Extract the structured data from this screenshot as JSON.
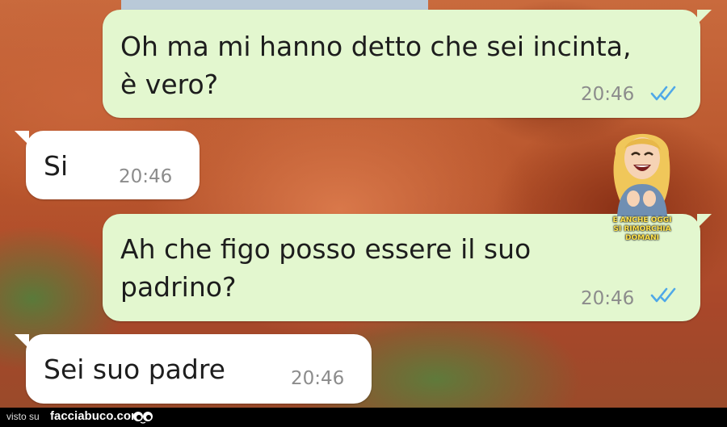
{
  "messages": [
    {
      "direction": "sent",
      "text": "Oh ma mi hanno detto che sei incinta,\nè vero?",
      "time": "20:46",
      "status": "read"
    },
    {
      "direction": "received",
      "text": "Si",
      "time": "20:46"
    },
    {
      "direction": "sent",
      "text": "Ah che figo posso essere il suo\npadrino?",
      "time": "20:46",
      "status": "read"
    },
    {
      "direction": "received",
      "text": "Sei suo padre",
      "time": "20:46"
    }
  ],
  "sticker": {
    "caption_line1": "E ANCHE OGGI",
    "caption_line2": "SI RIMORCHIA DOMANI"
  },
  "footer": {
    "visto": "visto su",
    "site": "facciabuco.com"
  },
  "colors": {
    "sent_bubble": "#e3f7cf",
    "received_bubble": "#ffffff",
    "read_ticks": "#4fa8e8",
    "timestamp": "#8c8c8c"
  }
}
